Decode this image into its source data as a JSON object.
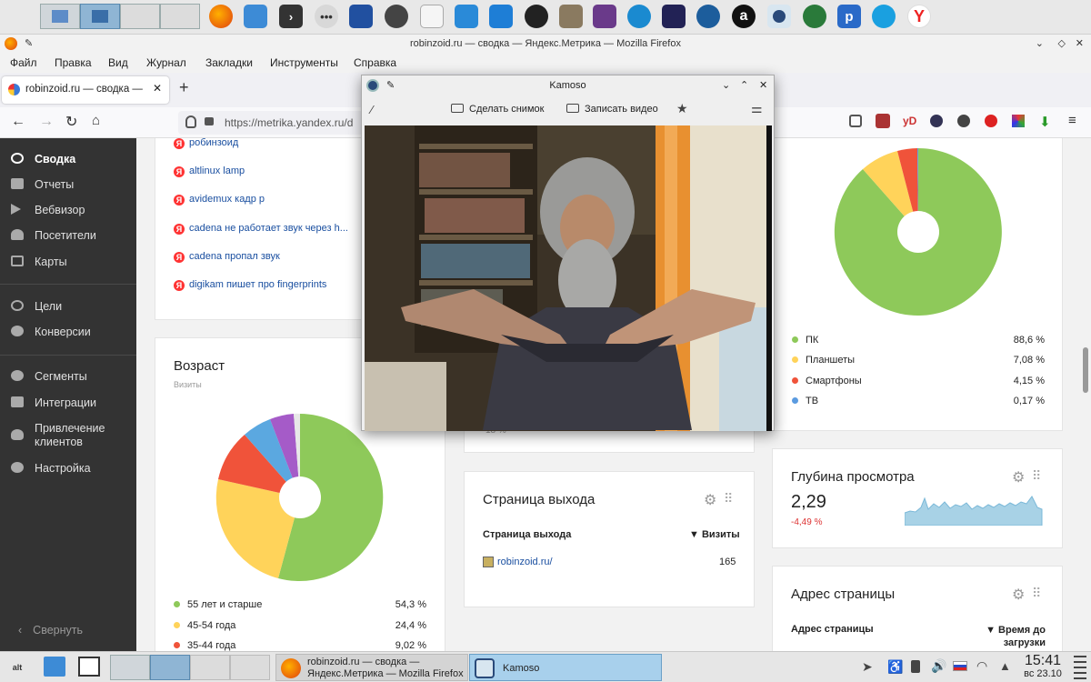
{
  "top_panel": {
    "icons": [
      "pager-desktop-1",
      "pager-desktop-2",
      "firefox-icon",
      "file-manager-icon",
      "terminal-icon",
      "more-icon",
      "video-editor-icon",
      "disc-icon",
      "document-icon",
      "package-icon",
      "text-editor-icon",
      "tux-icon",
      "gimp-icon",
      "image-viewer-icon",
      "headphones-icon",
      "media-icon",
      "ball-icon",
      "a-icon",
      "webcam-icon",
      "globe-icon",
      "p-icon",
      "network-icon",
      "yandex-browser-icon"
    ]
  },
  "browser": {
    "window_title": "robinzoid.ru — сводка — Яндекс.Метрика — Mozilla Firefox",
    "menu": [
      "Файл",
      "Правка",
      "Вид",
      "Журнал",
      "Закладки",
      "Инструменты",
      "Справка"
    ],
    "tab_title": "robinzoid.ru — сводка — Ян",
    "url": "https://metrika.yandex.ru/d",
    "toolbar_ext": [
      "yD"
    ]
  },
  "sidebar": {
    "items": [
      {
        "label": "Сводка",
        "icon": "dashboard-icon"
      },
      {
        "label": "Отчеты",
        "icon": "bar-chart-icon"
      },
      {
        "label": "Вебвизор",
        "icon": "play-icon"
      },
      {
        "label": "Посетители",
        "icon": "user-icon"
      },
      {
        "label": "Карты",
        "icon": "map-icon"
      },
      {
        "label": "Цели",
        "icon": "target-icon"
      },
      {
        "label": "Конверсии",
        "icon": "percent-icon"
      },
      {
        "label": "Сегменты",
        "icon": "pie-icon"
      },
      {
        "label": "Интеграции",
        "icon": "puzzle-icon"
      },
      {
        "label": "Привлечение клиентов",
        "icon": "fire-icon"
      },
      {
        "label": "Настройка",
        "icon": "gear-icon"
      }
    ],
    "collapse": "Свернуть"
  },
  "queries": [
    "робинзоид",
    "altlinux lamp",
    "avidemux кадр р",
    "cadena не работает звук через h...",
    "cadena пропал звук",
    "digikam пишет про fingerprints"
  ],
  "age_card": {
    "title": "Возраст",
    "subtitle": "Визиты",
    "legend": [
      {
        "label": "55 лет и старше",
        "value": "54,3 %",
        "color": "#8ec95a"
      },
      {
        "label": "45-54 года",
        "value": "24,4 %",
        "color": "#ffd35a"
      },
      {
        "label": "35-44 года",
        "value": "9,02 %",
        "color": "#f0533a"
      }
    ]
  },
  "devices_card": {
    "legend": [
      {
        "label": "ПК",
        "value": "88,6 %",
        "color": "#8ec95a"
      },
      {
        "label": "Планшеты",
        "value": "7,08 %",
        "color": "#ffd35a"
      },
      {
        "label": "Смартфоны",
        "value": "4,15 %",
        "color": "#f0533a"
      },
      {
        "label": "ТВ",
        "value": "0,17 %",
        "color": "#5b9be0"
      }
    ]
  },
  "exit_card": {
    "title": "Страница выхода",
    "col1": "Страница выхода",
    "col2": "▼ Визиты",
    "row_page": "robinzoid.ru/",
    "row_visits": "165"
  },
  "depth_card": {
    "title": "Глубина просмотра",
    "value": "2,29",
    "delta": "-4,49 %"
  },
  "address_card": {
    "title": "Адрес страницы",
    "col1": "Адрес страницы",
    "col2": "▼ Время до загрузки DOM"
  },
  "partial_text": "18 %",
  "kamoso": {
    "title": "Kamoso",
    "snapshot": "Сделать снимок",
    "record": "Записать видео"
  },
  "taskbar": {
    "firefox_task": "robinzoid.ru — сводка — Яндекс.Метрика — Mozilla Firefox",
    "kamoso_task": "Kamoso",
    "time": "15:41",
    "date": "вс 23.10",
    "alt_label": "alt"
  }
}
